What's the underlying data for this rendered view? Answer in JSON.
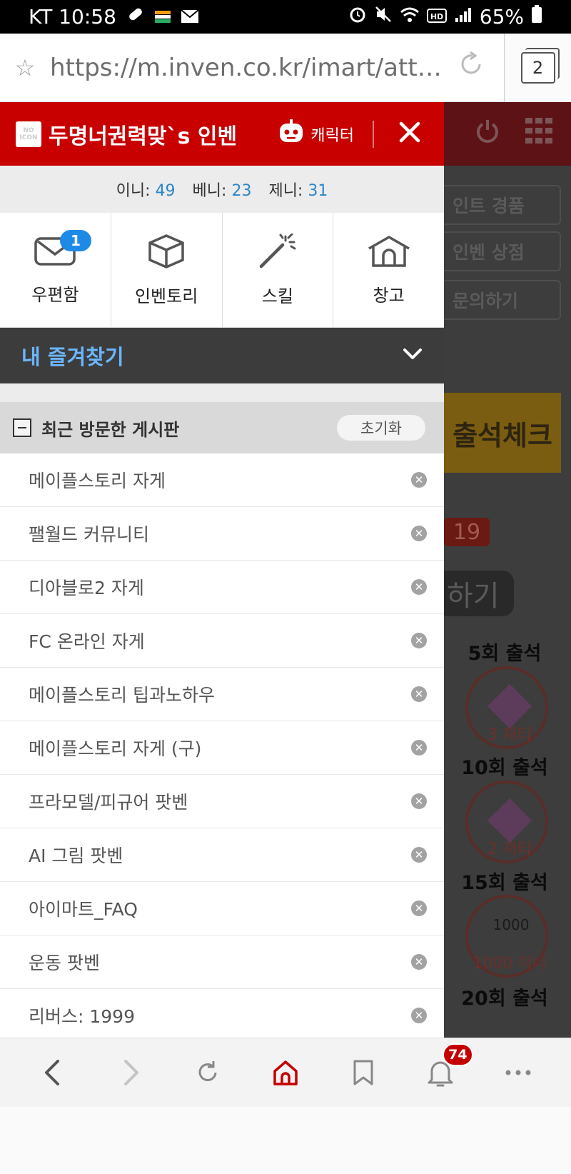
{
  "status_bar": {
    "carrier_time": "KT 10:58",
    "battery": "65%"
  },
  "url_bar": {
    "url": "https://m.inven.co.kr/imart/attenda...",
    "tab_count": "2"
  },
  "drawer": {
    "user_name": "두명너권력맞`s 인벤",
    "character_label": "캐릭터",
    "noicon_text": "NO ICON",
    "currencies": [
      {
        "label": "이니:",
        "value": "49"
      },
      {
        "label": "베니:",
        "value": "23"
      },
      {
        "label": "제니:",
        "value": "31"
      }
    ],
    "menu": [
      {
        "label": "우편함",
        "icon": "mail-icon",
        "badge": "1"
      },
      {
        "label": "인벤토리",
        "icon": "box-icon"
      },
      {
        "label": "스킬",
        "icon": "magic-wand-icon"
      },
      {
        "label": "창고",
        "icon": "house-icon"
      }
    ],
    "favorites_title": "내 즐겨찾기",
    "recent_title": "최근 방문한 게시판",
    "reset_label": "초기화",
    "recent_boards": [
      "메이플스토리 자게",
      "팰월드 커뮤니티",
      "디아블로2 자게",
      "FC 온라인 자게",
      "메이플스토리 팁과노하우",
      "메이플스토리 자게 (구)",
      "프라모델/피규어 팟벤",
      "AI 그림 팟벤",
      "아이마트_FAQ",
      "운동 팟벤",
      "리버스: 1999"
    ]
  },
  "background_page": {
    "buttons": [
      "인트 경품",
      "인벤 상점",
      "문의하기"
    ],
    "attendance_banner": "출석체크",
    "count_badge": "19",
    "action_pill": "하기",
    "rewards": [
      {
        "title": "5회 출석",
        "stamp_text": "3 재티"
      },
      {
        "title": "10회 출석",
        "stamp_text": "2 재티"
      },
      {
        "title": "15회 출석",
        "stamp_text": "1000 이니",
        "coin": "1000"
      },
      {
        "title": "20회 출석"
      }
    ]
  },
  "bottom_nav": {
    "items": [
      "back-icon",
      "forward-icon",
      "refresh-icon",
      "home-icon",
      "bookmark-icon",
      "bell-icon",
      "more-icon"
    ],
    "notification_count": "74",
    "home_color": "#c40000"
  }
}
